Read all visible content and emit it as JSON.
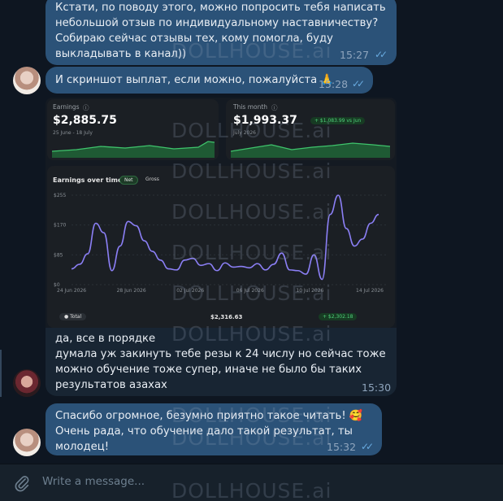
{
  "messages": {
    "m1": {
      "text": "Кстати, по поводу этого, можно попросить тебя написать небольшой отзыв по индивидуальному наставничеству?\nСобираю сейчас отзывы тех, кому помогла, буду выкладывать в канал))",
      "time": "15:27"
    },
    "m2": {
      "text": "И скриншот выплат, если можно, пожалуйста 🙏",
      "time": "15:28"
    },
    "m3": {
      "text": "да, все в порядке\nдумала уж закинуть тебе резы к 24 числу но сейчас тоже можно обучение тоже супер, иначе не было бы таких результатов азахах",
      "time": "15:30"
    },
    "m4": {
      "text": "Спасибо огромное, безумно приятно такое читать! 🥰\nОчень рада, что обучение дало такой результат, ты молодец!",
      "time": "15:32"
    }
  },
  "screenshot": {
    "earnings": {
      "label": "Earnings",
      "value": "$2,885.75",
      "period": "25 June - 18 July"
    },
    "this_month": {
      "label": "This month",
      "value": "$1,993.37",
      "delta": "+ $1,083.99 vs Jun",
      "period": "July 2026"
    },
    "over_time": {
      "title": "Earnings over time",
      "toggle_net": "Net",
      "toggle_gross": "Gross",
      "footer_total": "● Total",
      "footer_value": "$2,316.63",
      "footer_delta": "+ $2,302.18"
    }
  },
  "chart_data": {
    "type": "line",
    "title": "Earnings over time",
    "ytick_labels": [
      "$255",
      "$170",
      "$85",
      "$0"
    ],
    "xtick_labels": [
      "24 Jun 2026",
      "28 Jun 2026",
      "02 Jul 2026",
      "06 Jul 2026",
      "10 Jul 2026",
      "14 Jul 2026"
    ],
    "ylim": [
      0,
      255
    ],
    "series": [
      {
        "color": "#8b7ff5",
        "values": [
          45,
          58,
          88,
          175,
          148,
          40,
          110,
          180,
          168,
          125,
          95,
          70,
          45,
          42,
          70,
          75,
          55,
          60,
          40,
          62,
          50,
          52,
          48,
          60,
          42,
          58,
          90,
          42,
          40,
          30,
          85,
          15,
          200,
          255,
          160,
          110,
          130,
          175,
          200
        ]
      }
    ],
    "grid": true
  },
  "watermark": "DOLLHOUSE.ai",
  "composer": {
    "placeholder": "Write a message..."
  },
  "colors": {
    "outgoing": "#2b5278",
    "incoming": "#182533",
    "background": "#0e1621",
    "accent_line": "#8b7ff5"
  }
}
